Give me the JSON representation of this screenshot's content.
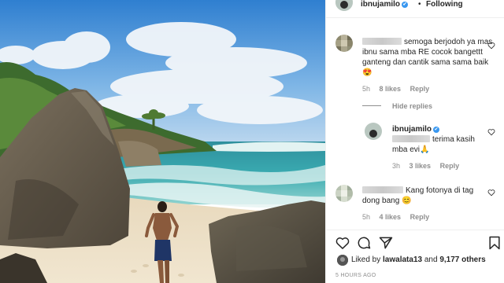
{
  "header": {
    "username": "ibnujamilo",
    "verified_glyph": "✔",
    "separator": "•",
    "follow_label": "Following"
  },
  "comments": [
    {
      "text": "semoga berjodoh ya mas ibnu sama mba RE cocok bangettt ganteng dan cantik sama sama baik",
      "emoji": "😍",
      "time": "5h",
      "likes": "8 likes",
      "reply_label": "Reply"
    },
    {
      "username": "ibnujamilo",
      "text": "terima kasih mba evi",
      "emoji": "🙏",
      "time": "3h",
      "likes": "3 likes",
      "reply_label": "Reply"
    },
    {
      "text": "Kang fotonya di tag dong bang",
      "emoji": "😊",
      "time": "5h",
      "likes": "4 likes",
      "reply_label": "Reply"
    }
  ],
  "hide_replies_label": "Hide replies",
  "actions": {
    "icons": [
      "heart-icon",
      "comment-icon",
      "share-icon",
      "bookmark-icon"
    ]
  },
  "likes_line": {
    "prefix": "Liked by",
    "user": "lawalata13",
    "and": "and",
    "others": "9,177 others"
  },
  "timestamp": "5 HOURS AGO",
  "colors": {
    "verified": "#3897f0",
    "meta_text": "#8e8e8e",
    "divider": "#efefef"
  }
}
